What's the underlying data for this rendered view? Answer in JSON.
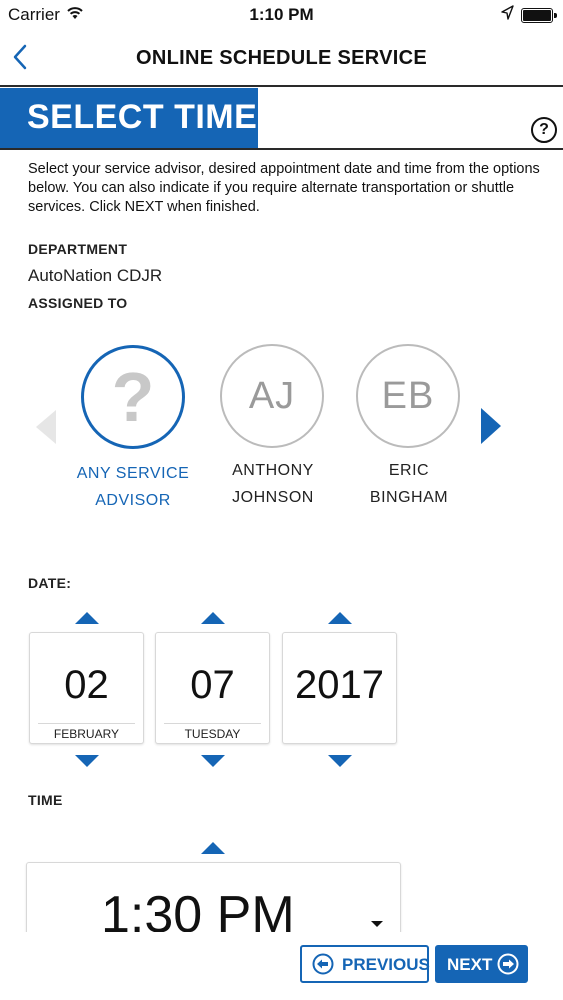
{
  "status_bar": {
    "carrier": "Carrier",
    "time": "1:10 PM"
  },
  "nav": {
    "title": "ONLINE SCHEDULE SERVICE"
  },
  "header": {
    "title": "SELECT TIME",
    "help_label": "?"
  },
  "intro_text": "Select your service advisor, desired appointment date and time from the options below. You can also indicate if you require alternate transportation or shuttle services. Click NEXT when finished.",
  "department": {
    "label": "DEPARTMENT",
    "value": "AutoNation CDJR"
  },
  "assigned_to": {
    "label": "ASSIGNED TO",
    "advisors": [
      {
        "initials": "?",
        "first": "ANY SERVICE",
        "last": "ADVISOR",
        "selected": true
      },
      {
        "initials": "AJ",
        "first": "ANTHONY",
        "last": "JOHNSON",
        "selected": false
      },
      {
        "initials": "EB",
        "first": "ERIC",
        "last": "BINGHAM",
        "selected": false
      }
    ]
  },
  "date": {
    "label": "DATE:",
    "month": {
      "value": "02",
      "sub": "FEBRUARY"
    },
    "day": {
      "value": "07",
      "sub": "TUESDAY"
    },
    "year": {
      "value": "2017",
      "sub": ""
    }
  },
  "time": {
    "label": "TIME",
    "value": "1:30 PM"
  },
  "buttons": {
    "previous": "PREVIOUS",
    "next": "NEXT"
  },
  "colors": {
    "accent": "#1565b5",
    "text": "#222222",
    "muted": "#9a9a9a"
  }
}
